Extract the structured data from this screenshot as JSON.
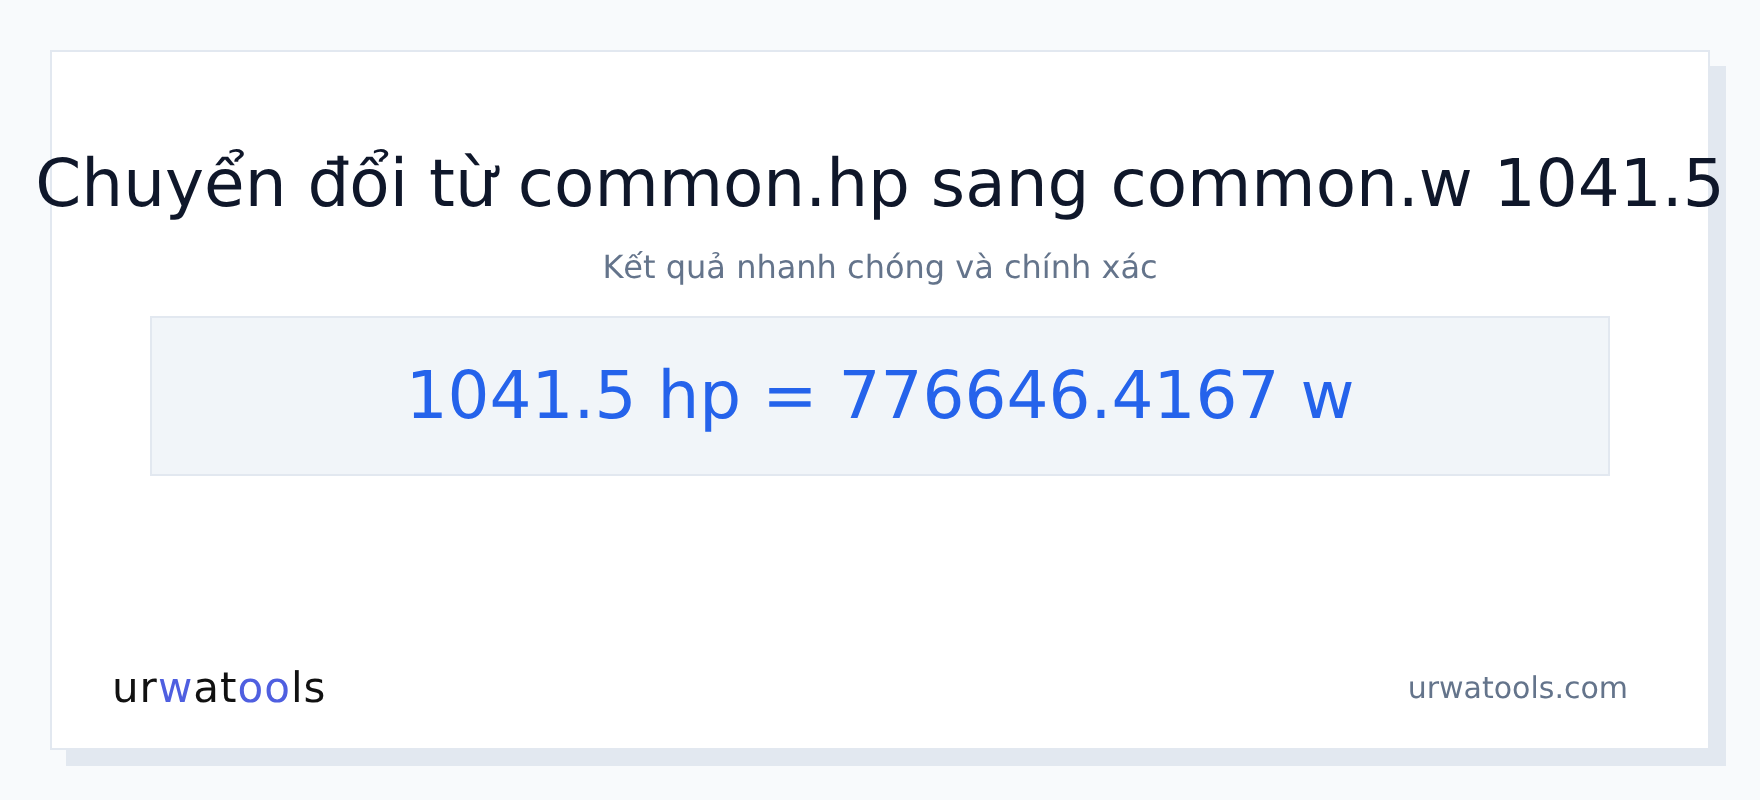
{
  "title": "Chuyển đổi từ common.hp sang common.w 1041.5",
  "subtitle": "Kết quả nhanh chóng và chính xác",
  "result": "1041.5 hp = 776646.4167 w",
  "logo": [
    {
      "text": "ur",
      "accent": false
    },
    {
      "text": "w",
      "accent": true
    },
    {
      "text": "at",
      "accent": false
    },
    {
      "text": "oo",
      "accent": true
    },
    {
      "text": "ls",
      "accent": false
    }
  ],
  "site": "urwatools.com"
}
